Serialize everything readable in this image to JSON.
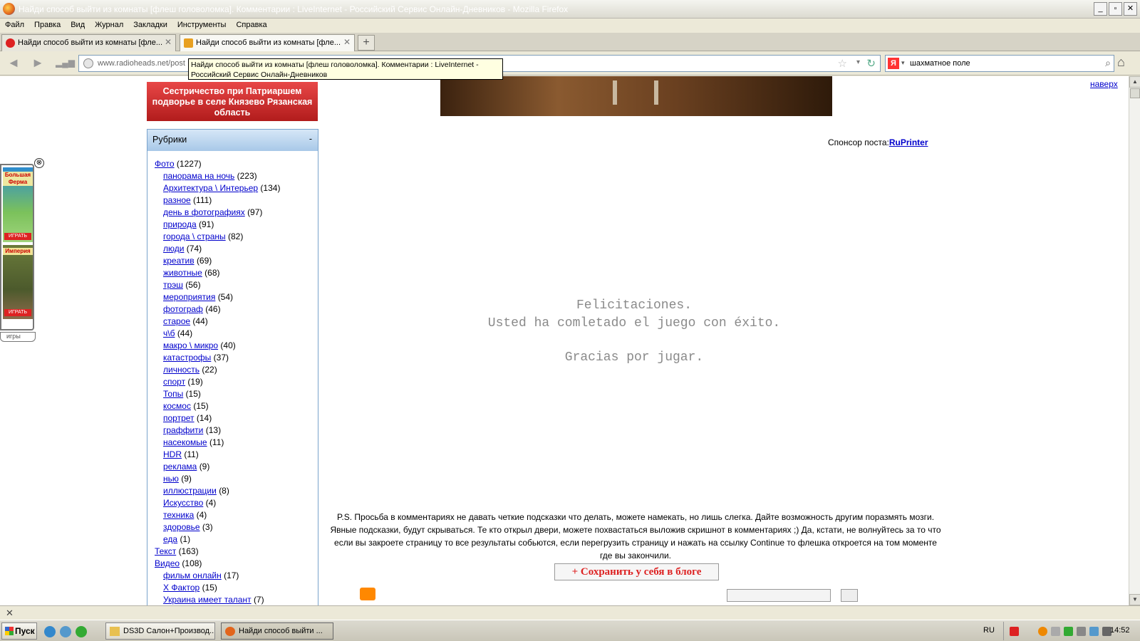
{
  "window": {
    "title": "Найди способ выйти из комнаты [флеш головоломка]. Комментарии : LiveInternet - Российский Сервис Онлайн-Дневников - Mozilla Firefox",
    "minimize": "_",
    "maximize": "▫",
    "close": "✕"
  },
  "menu": [
    "Файл",
    "Правка",
    "Вид",
    "Журнал",
    "Закладки",
    "Инструменты",
    "Справка"
  ],
  "tabs": [
    {
      "label": "Найди способ выйти из комнаты [фле...",
      "close": "✕"
    },
    {
      "label": "Найди способ выйти из комнаты [фле...",
      "close": "✕"
    }
  ],
  "new_tab": "+",
  "nav": {
    "back": "◄",
    "forward": "►",
    "url": "www.radioheads.net/post",
    "search_value": "шахматное поле",
    "search_engine": "Я",
    "star": "☆",
    "drop": "▾",
    "reload": "↻",
    "magnifier": "⌕",
    "home": "⌂"
  },
  "tooltip": "Найди способ выйти из комнаты [флеш головоломка]. Комментарии : LiveInternet - Российский Сервис Онлайн-Дневников",
  "red_banner": "Сестричество при Патриаршем подворье в селе Князево Рязанская область",
  "top_link": "наверх",
  "rubrics": {
    "title": "Рубрики",
    "toggle": "-",
    "items": [
      {
        "label": "Фото",
        "count": "(1227)",
        "sub": false
      },
      {
        "label": "панорама на ночь",
        "count": "(223)",
        "sub": true
      },
      {
        "label": "Архитектура \\ Интерьер",
        "count": "(134)",
        "sub": true
      },
      {
        "label": "разное",
        "count": "(111)",
        "sub": true
      },
      {
        "label": "день в фотографиях",
        "count": "(97)",
        "sub": true
      },
      {
        "label": "природа",
        "count": "(91)",
        "sub": true
      },
      {
        "label": "города \\ страны",
        "count": "(82)",
        "sub": true
      },
      {
        "label": "люди",
        "count": "(74)",
        "sub": true
      },
      {
        "label": "креатив",
        "count": "(69)",
        "sub": true
      },
      {
        "label": "животные",
        "count": "(68)",
        "sub": true
      },
      {
        "label": "трэш",
        "count": "(56)",
        "sub": true
      },
      {
        "label": "мероприятия",
        "count": "(54)",
        "sub": true
      },
      {
        "label": "фотограф",
        "count": "(46)",
        "sub": true
      },
      {
        "label": "старое",
        "count": "(44)",
        "sub": true
      },
      {
        "label": "ч\\б",
        "count": "(44)",
        "sub": true
      },
      {
        "label": "макро \\ микро",
        "count": "(40)",
        "sub": true
      },
      {
        "label": "катастрофы",
        "count": "(37)",
        "sub": true
      },
      {
        "label": "личность",
        "count": "(22)",
        "sub": true
      },
      {
        "label": "спорт",
        "count": "(19)",
        "sub": true
      },
      {
        "label": "Топы",
        "count": "(15)",
        "sub": true
      },
      {
        "label": "космос",
        "count": "(15)",
        "sub": true
      },
      {
        "label": "портрет",
        "count": "(14)",
        "sub": true
      },
      {
        "label": "граффити",
        "count": "(13)",
        "sub": true
      },
      {
        "label": "насекомые",
        "count": "(11)",
        "sub": true
      },
      {
        "label": "HDR",
        "count": "(11)",
        "sub": true
      },
      {
        "label": "реклама",
        "count": "(9)",
        "sub": true
      },
      {
        "label": "нью",
        "count": "(9)",
        "sub": true
      },
      {
        "label": "иллюстрации",
        "count": "(8)",
        "sub": true
      },
      {
        "label": "Искусство",
        "count": "(4)",
        "sub": true
      },
      {
        "label": "техника",
        "count": "(4)",
        "sub": true
      },
      {
        "label": "здоровье",
        "count": "(3)",
        "sub": true
      },
      {
        "label": "еда",
        "count": "(1)",
        "sub": true
      },
      {
        "label": "Текст",
        "count": "(163)",
        "sub": false
      },
      {
        "label": "Видео",
        "count": "(108)",
        "sub": false
      },
      {
        "label": "фильм онлайн",
        "count": "(17)",
        "sub": true
      },
      {
        "label": "Х Фактор",
        "count": "(15)",
        "sub": true
      },
      {
        "label": "Украина имеет талант",
        "count": "(7)",
        "sub": true
      }
    ]
  },
  "sponsor": {
    "label": "Спонсор поста:",
    "link": "RuPrinter"
  },
  "flash_message": {
    "line1": "Felicitaciones.",
    "line2": "Usted ha comletado el juego con éxito.",
    "line3": "Gracias por jugar."
  },
  "ps_text": "P.S. Просьба в комментариях не давать четкие подсказки что делать, можете намекать, но лишь слегка. Дайте возможность другим поразмять мозги. Явные подсказки, будут скрываться. Те кто открыл двери, можете похвастаться выложив скришнот в комментариях ;) Да, кстати, не волнуйтесь за то что если вы закроете страницу то все результаты собьются, если перегрузить страницу и нажать на ссылку Continue то флешка откроется на том моменте где вы закончили.",
  "save_button": "+ Сохранить у себя в блоге",
  "games_widget": {
    "game1": "Большая Ферма",
    "game2": "Империя",
    "play": "ИГРАТЬ",
    "tab": "игры",
    "close": "⊗"
  },
  "status_close": "✕",
  "taskbar": {
    "start": "Пуск",
    "tasks": [
      {
        "label": "DS3D Салон+Производ...",
        "active": false
      },
      {
        "label": "Найди способ выйти ...",
        "active": true
      }
    ],
    "lang": "RU",
    "clock": "14:52"
  },
  "scroll": {
    "up": "▲",
    "down": "▼"
  }
}
